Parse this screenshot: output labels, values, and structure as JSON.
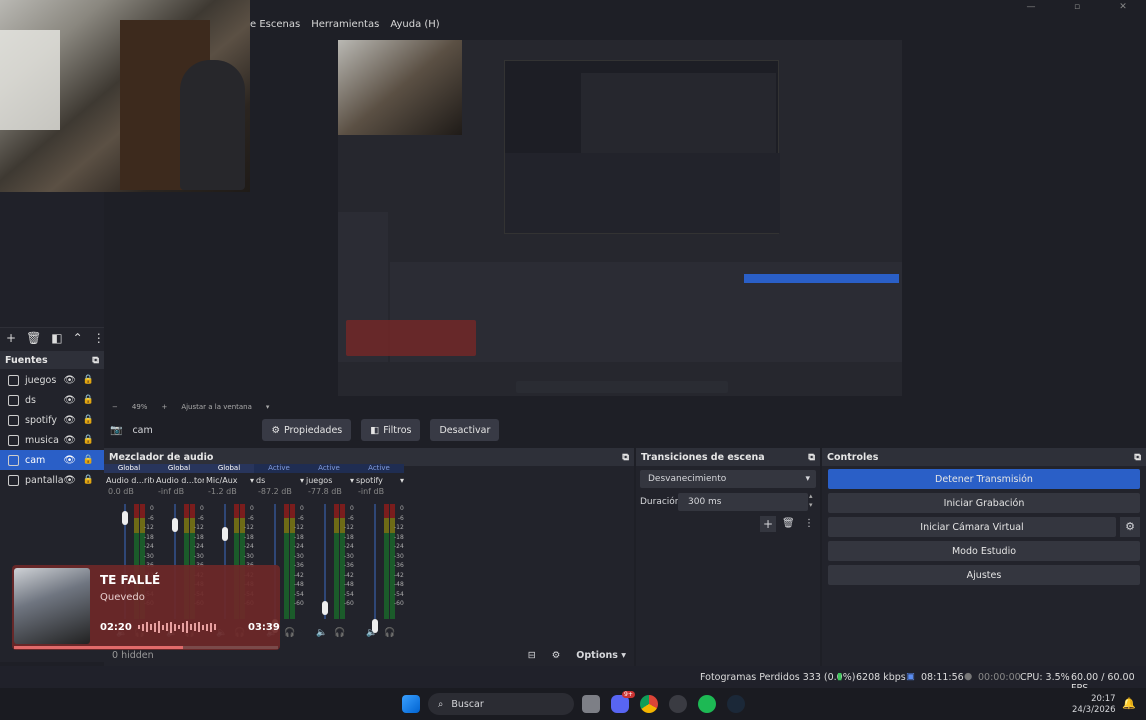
{
  "menu": {
    "items": [
      "e Escenas",
      "Herramientas",
      "Ayuda (H)"
    ]
  },
  "canvas": {
    "zoom": "49%",
    "fit": "Ajustar a la ventana"
  },
  "sources": {
    "title": "Fuentes",
    "items": [
      {
        "name": "juegos",
        "icon": "gamepad-icon"
      },
      {
        "name": "ds",
        "icon": "display-icon"
      },
      {
        "name": "spotify",
        "icon": "audio-icon"
      },
      {
        "name": "musica",
        "icon": "globe-icon"
      },
      {
        "name": "cam",
        "icon": "camera-icon",
        "selected": true
      },
      {
        "name": "pantalla",
        "icon": "window-icon"
      }
    ]
  },
  "propbar": {
    "source": "cam",
    "props": "Propiedades",
    "filters": "Filtros",
    "deactivate": "Desactivar"
  },
  "mixer": {
    "title": "Mezclador de audio",
    "channels": [
      {
        "header": "Global",
        "type": "g",
        "name": "Audio d...ritorio",
        "db": "0.0 dB"
      },
      {
        "header": "Global",
        "type": "g",
        "name": "Audio d...torio 2",
        "db": "-inf dB"
      },
      {
        "header": "Global",
        "type": "g",
        "name": "Mic/Aux",
        "db": "-1.2 dB"
      },
      {
        "header": "Active",
        "type": "a",
        "name": "ds",
        "db": "-87.2 dB"
      },
      {
        "header": "Active",
        "type": "a",
        "name": "juegos",
        "db": "-77.8 dB"
      },
      {
        "header": "Active",
        "type": "a",
        "name": "spotify",
        "db": "-inf dB"
      }
    ],
    "ticks": [
      "0",
      "-6",
      "-12",
      "-18",
      "-24",
      "-30",
      "-36",
      "-42",
      "-48",
      "-54",
      "-60"
    ],
    "hidden": "0 hidden",
    "options": "Options"
  },
  "transitions": {
    "title": "Transiciones de escena",
    "selected": "Desvanecimiento",
    "duration_label": "Duración",
    "duration": "300 ms"
  },
  "controls": {
    "title": "Controles",
    "buttons": [
      "Detener Transmisión",
      "Iniciar Grabación",
      "Iniciar Cámara Virtual",
      "Modo Estudio",
      "Ajustes"
    ]
  },
  "status": {
    "dropped": "Fotogramas Perdidos 333 (0.0%)",
    "kbps": "6208 kbps",
    "stream_time": "08:11:56",
    "rec_time": "00:00:00",
    "cpu": "CPU: 3.5%",
    "fps": "60.00 / 60.00 FPS"
  },
  "spotify": {
    "title": "TE FALLÉ",
    "artist": "Quevedo",
    "elapsed": "02:20",
    "total": "03:39",
    "progress": 0.64
  },
  "taskbar": {
    "search": "Buscar",
    "time": "20:17",
    "date": "24/3/2026",
    "badge": "9+"
  }
}
